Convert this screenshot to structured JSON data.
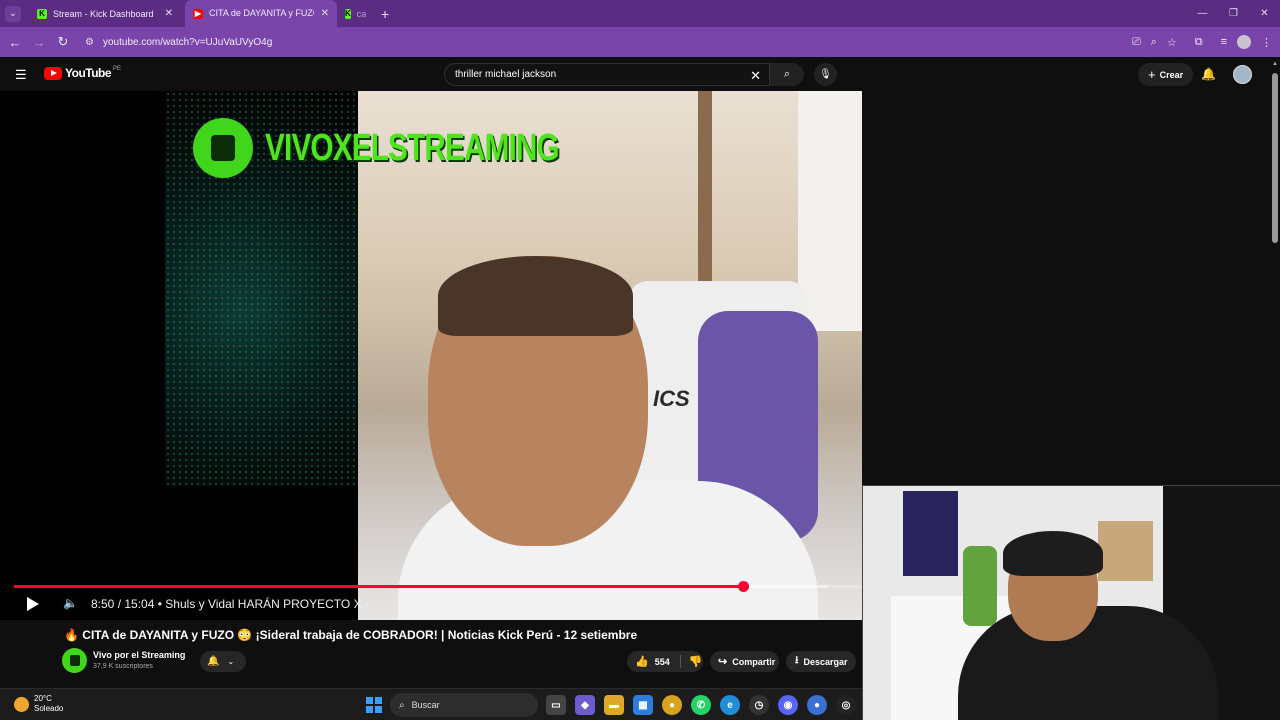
{
  "browser": {
    "tabs": [
      {
        "title": "Stream - Kick Dashboard",
        "favicon": "kick-icon",
        "active": false
      },
      {
        "title": "CITA de DAYANITA y FUZO 🔥",
        "favicon": "youtube-icon",
        "active": true
      },
      {
        "title": "ca",
        "favicon": "kick-icon",
        "active": false
      }
    ],
    "url": "youtube.com/watch?v=UJuVaUVyO4g",
    "accent": "#7a45ab"
  },
  "youtube": {
    "logo_text": "YouTube",
    "country": "PE",
    "search_value": "thriller michael jackson",
    "create_label": "Crear"
  },
  "video": {
    "overlay_title": "VIVOXELSTREAMING",
    "time_current": "8:50",
    "time_total": "15:04",
    "chapter": "Shuls y Vidal HARÁN PROYECTO X",
    "progress_fraction": 0.86,
    "buffer_fraction": 0.96,
    "title": "🔥 CITA de DAYANITA y FUZO 😳 ¡Sideral trabaja de COBRADOR! | Noticias Kick Perú - 12 setiembre",
    "channel_name": "Vivo por el Streaming",
    "subscribers": "37,9 K suscriptores",
    "likes": "554",
    "share_label": "Compartir",
    "download_label": "Descargar",
    "play_progress_color": "#ff0033"
  },
  "taskbar": {
    "temperature": "20°C",
    "condition": "Soleado",
    "search_label": "Buscar"
  }
}
